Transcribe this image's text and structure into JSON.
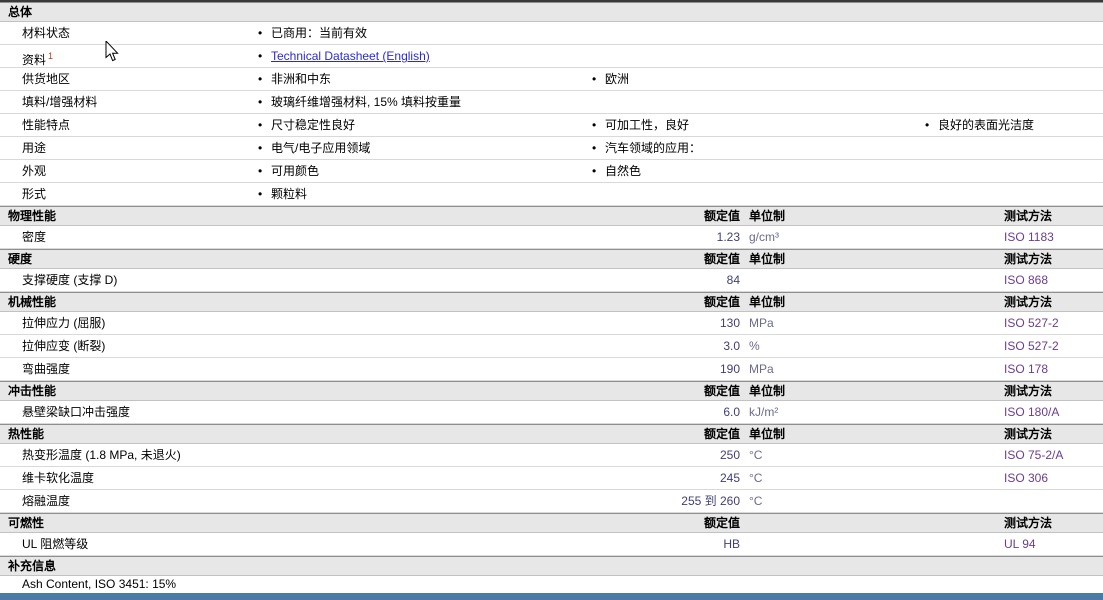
{
  "general": {
    "title": "总体",
    "rows": [
      {
        "label": "材料状态",
        "c1": "已商用：当前有效",
        "c2": "",
        "c3": ""
      },
      {
        "label": "资料",
        "footnote": "1",
        "link": "Technical Datasheet (English)"
      },
      {
        "label": "供货地区",
        "c1": "非洲和中东",
        "c2": "欧洲",
        "c3": ""
      },
      {
        "label": "填料/增强材料",
        "c1": "玻璃纤维增强材料, 15% 填料按重量",
        "c2": "",
        "c3": ""
      },
      {
        "label": "性能特点",
        "c1": "尺寸稳定性良好",
        "c2": "可加工性，良好",
        "c3": "良好的表面光洁度"
      },
      {
        "label": "用途",
        "c1": "电气/电子应用领域",
        "c2": "汽车领域的应用：",
        "c3": ""
      },
      {
        "label": "外观",
        "c1": "可用颜色",
        "c2": "自然色",
        "c3": ""
      },
      {
        "label": "形式",
        "c1": "颗粒料",
        "c2": "",
        "c3": ""
      }
    ]
  },
  "sections": [
    {
      "title": "物理性能",
      "cols": {
        "value": "额定值",
        "unit": "单位制",
        "method": "测试方法"
      },
      "rows": [
        {
          "label": "密度",
          "value": "1.23",
          "unit": "g/cm³",
          "method": "ISO 1183"
        }
      ]
    },
    {
      "title": "硬度",
      "cols": {
        "value": "额定值",
        "unit": "单位制",
        "method": "测试方法"
      },
      "rows": [
        {
          "label": "支撑硬度 (支撑 D)",
          "value": "84",
          "unit": "",
          "method": "ISO 868"
        }
      ]
    },
    {
      "title": "机械性能",
      "cols": {
        "value": "额定值",
        "unit": "单位制",
        "method": "测试方法"
      },
      "rows": [
        {
          "label": "拉伸应力 (屈服)",
          "value": "130",
          "unit": "MPa",
          "method": "ISO 527-2"
        },
        {
          "label": "拉伸应变 (断裂)",
          "value": "3.0",
          "unit": "%",
          "method": "ISO 527-2"
        },
        {
          "label": "弯曲强度",
          "value": "190",
          "unit": "MPa",
          "method": "ISO 178"
        }
      ]
    },
    {
      "title": "冲击性能",
      "cols": {
        "value": "额定值",
        "unit": "单位制",
        "method": "测试方法"
      },
      "rows": [
        {
          "label": "悬壁梁缺口冲击强度",
          "value": "6.0",
          "unit": "kJ/m²",
          "method": "ISO 180/A"
        }
      ]
    },
    {
      "title": "热性能",
      "cols": {
        "value": "额定值",
        "unit": "单位制",
        "method": "测试方法"
      },
      "rows": [
        {
          "label": "热变形温度 (1.8 MPa, 未退火)",
          "value": "250",
          "unit": "°C",
          "method": "ISO 75-2/A"
        },
        {
          "label": "维卡软化温度",
          "value": "245",
          "unit": "°C",
          "method": "ISO 306"
        },
        {
          "label": "熔融温度",
          "value": "255 到 260",
          "unit": "°C",
          "method": ""
        }
      ]
    },
    {
      "title": "可燃性",
      "cols": {
        "value": "额定值",
        "unit": "",
        "method": "测试方法"
      },
      "rows": [
        {
          "label": "UL 阻燃等级",
          "value": "HB",
          "unit": "",
          "method": "UL 94"
        }
      ]
    },
    {
      "title": "补充信息",
      "cols": {
        "value": "",
        "unit": "",
        "method": ""
      },
      "rows": [
        {
          "label": "Ash Content, ISO 3451: 15%",
          "value": "",
          "unit": "",
          "method": ""
        }
      ]
    }
  ],
  "footer": {
    "bar_color": "#4a7aa6"
  }
}
